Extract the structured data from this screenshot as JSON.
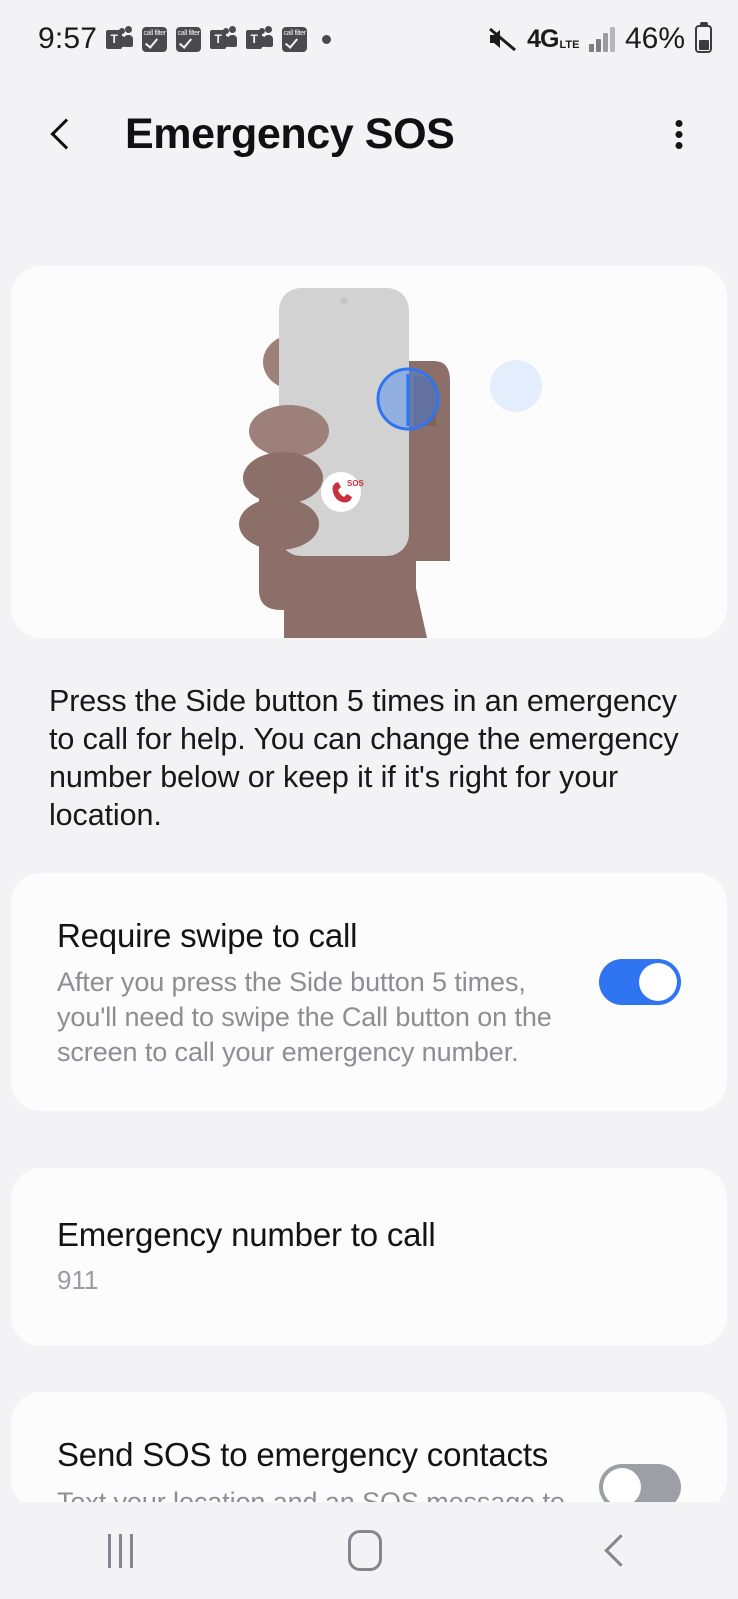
{
  "status_bar": {
    "time": "9:57",
    "notification_icons": [
      "teams-icon",
      "call-filter-icon",
      "call-filter-icon",
      "teams-icon",
      "teams-icon",
      "call-filter-icon",
      "dot-icon"
    ],
    "teams_letter": "T",
    "call_filter_label": "call filter",
    "mute_icon": "speaker-mute-icon",
    "network_type": "4G",
    "network_suffix": "LTE",
    "signal_icon": "signal-bars-icon",
    "battery_percent": "46%",
    "battery_icon": "battery-icon"
  },
  "app_bar": {
    "back_icon": "back-chevron-icon",
    "title": "Emergency SOS",
    "more_icon": "more-options-icon"
  },
  "illustration": {
    "name": "hand-holding-phone-pressing-side-button",
    "sos_badge_label": "SOS",
    "colors": {
      "hand": "#8c6f68",
      "finger": "#9c8079",
      "phone_body": "#d2d2d2",
      "highlight_circle": "#4285f4",
      "hint_dot": "#e3edfb",
      "sos_red": "#c8323c"
    }
  },
  "description": "Press the Side button 5 times in an emergency to call for help. You can change the emergency number below or keep it if it's right for your location.",
  "settings": [
    {
      "title": "Require swipe to call",
      "subtitle": "After you press the Side button 5 times, you'll need to swipe the Call button on the screen to call your emergency number.",
      "toggle": "on"
    },
    {
      "title": "Emergency number to call",
      "value": "911"
    },
    {
      "title": "Send SOS to emergency contacts",
      "subtitle": "Text your location and an SOS message to your emergency contacts.",
      "toggle": "off"
    }
  ],
  "nav_bar": {
    "recents_icon": "recents-icon",
    "home_icon": "home-icon",
    "back_icon": "nav-back-icon"
  },
  "colors": {
    "background": "#f3f3f5",
    "card": "#fcfcfd",
    "accent_on": "#2f74f0",
    "toggle_off": "#9ca0a6",
    "primary_text": "#131316",
    "secondary_text": "#8d8d93"
  }
}
